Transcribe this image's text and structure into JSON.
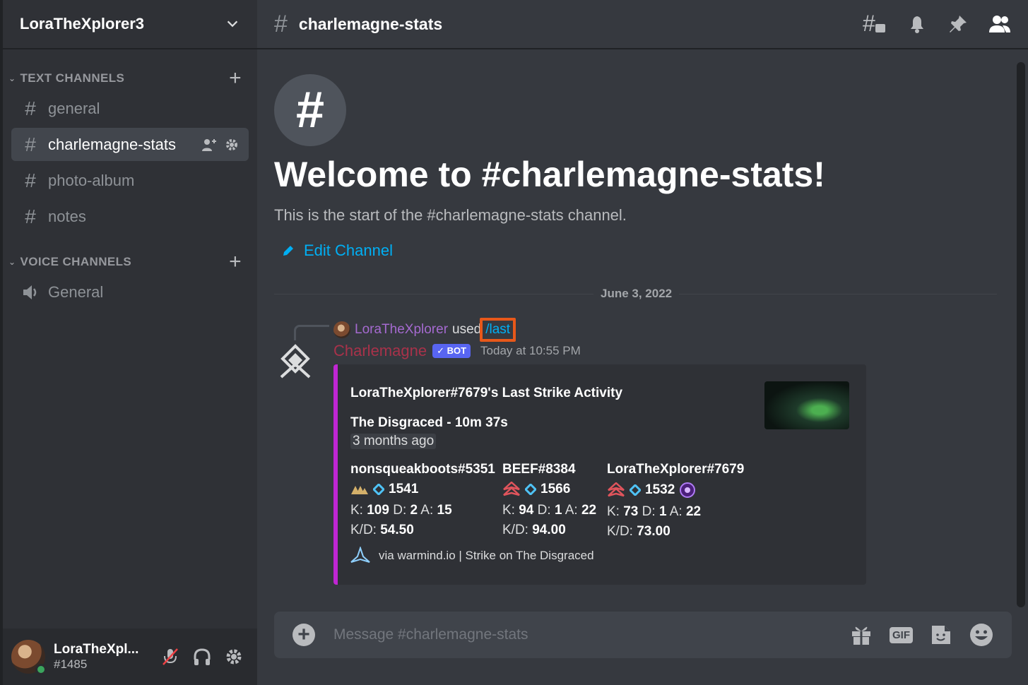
{
  "server": {
    "name": "LoraTheXplorer3"
  },
  "sidebar": {
    "categories": [
      {
        "label": "TEXT CHANNELS"
      },
      {
        "label": "VOICE CHANNELS"
      }
    ],
    "text_channels": [
      {
        "name": "general"
      },
      {
        "name": "charlemagne-stats"
      },
      {
        "name": "photo-album"
      },
      {
        "name": "notes"
      }
    ],
    "voice_channels": [
      {
        "name": "General"
      }
    ]
  },
  "user": {
    "name": "LoraTheXpl...",
    "tag": "#1485"
  },
  "topbar": {
    "channel": "charlemagne-stats"
  },
  "welcome": {
    "title": "Welcome to #charlemagne-stats!",
    "subtitle": "This is the start of the #charlemagne-stats channel.",
    "edit": "Edit Channel"
  },
  "divider": {
    "date": "June 3, 2022"
  },
  "reply": {
    "user": "LoraTheXplorer",
    "used": "used",
    "command": "/last"
  },
  "message": {
    "author": "Charlemagne",
    "badge": "✓ BOT",
    "time": "Today at 10:55 PM",
    "embed": {
      "title": "LoraTheXplorer#7679's Last Strike Activity",
      "activity": "The Disgraced - 10m 37s",
      "ago": "3 months ago",
      "players": [
        {
          "name": "nonsqueakboots#5351",
          "light": "1541",
          "k": "109",
          "d": "2",
          "a": "15",
          "kd": "54.50"
        },
        {
          "name": "BEEF#8384",
          "light": "1566",
          "k": "94",
          "d": "1",
          "a": "22",
          "kd": "94.00"
        },
        {
          "name": "LoraTheXplorer#7679",
          "light": "1532",
          "k": "73",
          "d": "1",
          "a": "22",
          "kd": "73.00"
        }
      ],
      "footer": "via warmind.io | Strike on The Disgraced"
    }
  },
  "composer": {
    "placeholder": "Message #charlemagne-stats",
    "gif": "GIF"
  },
  "colors": {
    "accent": "#00aff4",
    "embed_bar": "#c026d3",
    "bot_name": "#a8324a",
    "highlight": "#e8581a"
  }
}
